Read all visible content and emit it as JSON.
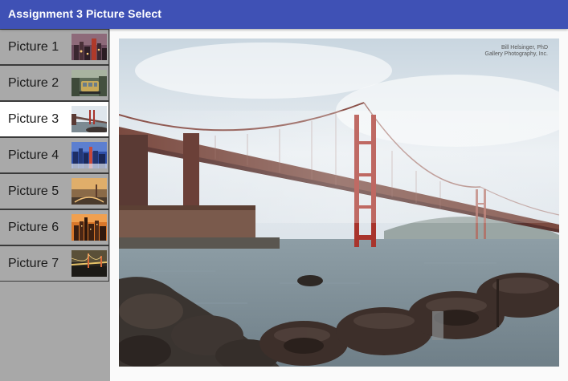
{
  "app": {
    "title": "Assignment 3 Picture Select"
  },
  "sidebar": {
    "selected_index": 2,
    "items": [
      {
        "label": "Picture 1",
        "thumb_icon": "city-night-thumbnail-icon"
      },
      {
        "label": "Picture 2",
        "thumb_icon": "cable-car-thumbnail-icon"
      },
      {
        "label": "Picture 3",
        "thumb_icon": "bridge-fog-thumbnail-icon"
      },
      {
        "label": "Picture 4",
        "thumb_icon": "skyline-blue-thumbnail-icon"
      },
      {
        "label": "Picture 5",
        "thumb_icon": "bay-sunset-thumbnail-icon"
      },
      {
        "label": "Picture 6",
        "thumb_icon": "skyline-orange-thumbnail-icon"
      },
      {
        "label": "Picture 7",
        "thumb_icon": "bridge-night-thumbnail-icon"
      }
    ]
  },
  "main": {
    "image_icon": "golden-gate-bridge-photo",
    "credit_line1": "Bill Helsinger, PhD",
    "credit_line2": "Gallery Photography, Inc."
  },
  "colors": {
    "app_bar": "#3f51b5",
    "sidebar_bg": "#a9a9a9",
    "selected_item_bg": "#ffffff",
    "bridge": "#a8342c"
  }
}
